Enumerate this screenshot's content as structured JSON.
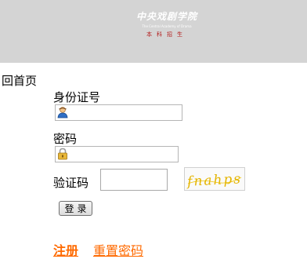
{
  "header": {
    "logo_cn": "中央戏剧学院",
    "logo_en": "The Central Academy of Drama",
    "logo_sub": "本科招生",
    "accent_color": "#b31b1b"
  },
  "nav": {
    "back_label": "回首页"
  },
  "form": {
    "id_label": "身份证号",
    "id_value": "",
    "id_icon": "user-icon",
    "password_label": "密码",
    "password_value": "",
    "password_icon": "lock-icon",
    "captcha_label": "验证码",
    "captcha_value": "",
    "captcha_image_text": "fnahps",
    "login_label": "登录"
  },
  "links": {
    "register_label": "注册",
    "reset_label": "重置密码",
    "color": "#ff6a00"
  }
}
